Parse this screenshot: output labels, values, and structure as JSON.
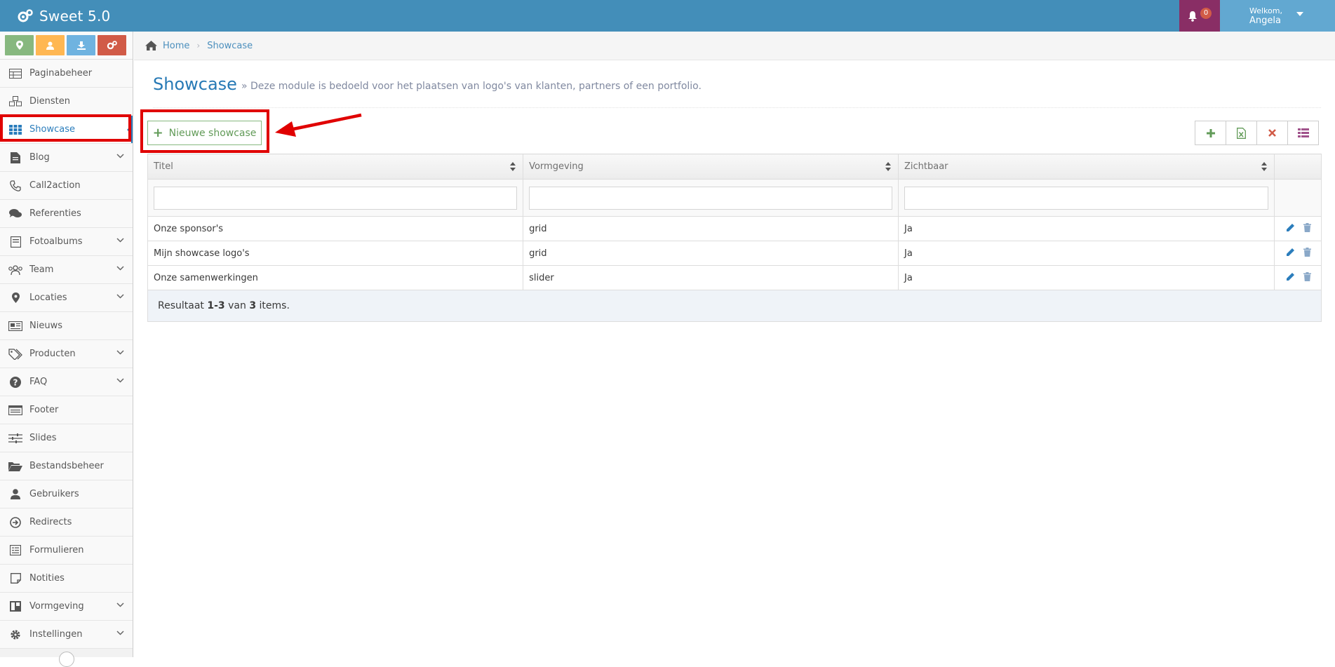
{
  "app": {
    "title": "Sweet 5.0"
  },
  "header": {
    "notifications_count": "0",
    "welcome": "Welkom,",
    "user_name": "Angela",
    "colors": {
      "navbar": "#438eb9",
      "notif": "#892e65",
      "user": "#62a8d1"
    }
  },
  "shortcuts": [
    {
      "icon": "map-marker-icon",
      "color": "#87b87f"
    },
    {
      "icon": "user-icon",
      "color": "#ffb752"
    },
    {
      "icon": "download-icon",
      "color": "#6fb3e0"
    },
    {
      "icon": "cogs-icon",
      "color": "#d15b47"
    }
  ],
  "sidebar": {
    "items": [
      {
        "label": "Paginabeheer",
        "icon": "table-icon"
      },
      {
        "label": "Diensten",
        "icon": "cubes-icon"
      },
      {
        "label": "Showcase",
        "icon": "grid-icon",
        "active": true
      },
      {
        "label": "Blog",
        "icon": "file-icon",
        "submenu": true
      },
      {
        "label": "Call2action",
        "icon": "phone-icon"
      },
      {
        "label": "Referenties",
        "icon": "comments-icon"
      },
      {
        "label": "Fotoalbums",
        "icon": "book-icon",
        "submenu": true
      },
      {
        "label": "Team",
        "icon": "users-icon",
        "submenu": true
      },
      {
        "label": "Locaties",
        "icon": "map-marker-icon",
        "submenu": true
      },
      {
        "label": "Nieuws",
        "icon": "newspaper-icon"
      },
      {
        "label": "Producten",
        "icon": "tags-icon",
        "submenu": true
      },
      {
        "label": "FAQ",
        "icon": "question-icon",
        "submenu": true
      },
      {
        "label": "Footer",
        "icon": "list-alt-icon"
      },
      {
        "label": "Slides",
        "icon": "sliders-icon"
      },
      {
        "label": "Bestandsbeheer",
        "icon": "folder-open-icon"
      },
      {
        "label": "Gebruikers",
        "icon": "user-icon"
      },
      {
        "label": "Redirects",
        "icon": "arrow-circle-icon"
      },
      {
        "label": "Formulieren",
        "icon": "form-icon"
      },
      {
        "label": "Notities",
        "icon": "sticky-note-icon"
      },
      {
        "label": "Vormgeving",
        "icon": "layout-icon",
        "submenu": true
      },
      {
        "label": "Instellingen",
        "icon": "cog-icon",
        "submenu": true
      }
    ]
  },
  "breadcrumbs": {
    "home": "Home",
    "current": "Showcase"
  },
  "page": {
    "title": "Showcase",
    "subtitle": "» Deze module is bedoeld voor het plaatsen van logo's van klanten, partners of een portfolio."
  },
  "actions": {
    "new_button": "Nieuwe showcase"
  },
  "table": {
    "columns": [
      "Titel",
      "Vormgeving",
      "Zichtbaar"
    ],
    "filters": [
      "",
      "",
      ""
    ],
    "rows": [
      [
        "Onze sponsor's",
        "grid",
        "Ja"
      ],
      [
        "Mijn showcase logo's",
        "grid",
        "Ja"
      ],
      [
        "Onze samenwerkingen",
        "slider",
        "Ja"
      ]
    ],
    "summary": {
      "prefix": "Resultaat",
      "range": "1-3",
      "mid": "van",
      "total": "3",
      "suffix": "items."
    }
  }
}
